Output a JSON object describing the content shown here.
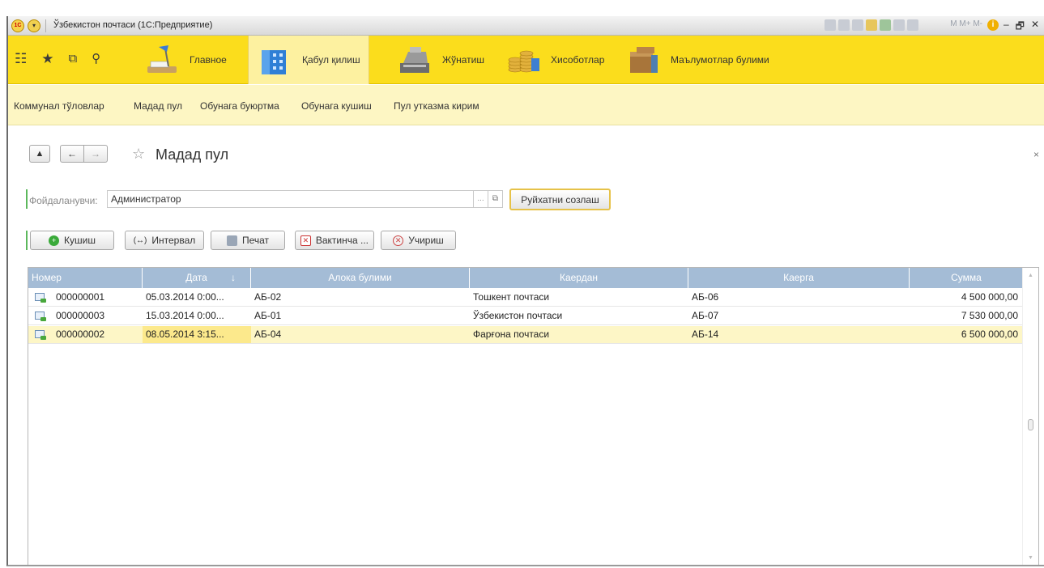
{
  "window": {
    "title": "Ўзбекистон почтаси  (1С:Предприятие)",
    "memory_label": "M  M+ M-",
    "controls": [
      "–",
      "🗗",
      "✕"
    ]
  },
  "icons": {
    "apps": "grid-icon",
    "favorites": "star-icon",
    "history": "history-icon",
    "search": "search-icon"
  },
  "sections": [
    {
      "label": "Главное",
      "icon": "desk-lamp-icon"
    },
    {
      "label": "Қабул қилиш",
      "icon": "building-icon",
      "active": true
    },
    {
      "label": "Жўнатиш",
      "icon": "cash-register-icon"
    },
    {
      "label": "Хисоботлар",
      "icon": "coins-icon"
    },
    {
      "label": "Маълумотлар булими",
      "icon": "boxes-icon"
    }
  ],
  "submenu": [
    "Коммунал тўловлар",
    "Мадад пул",
    "Обунага буюртма",
    "Обунага кушиш",
    "Пул утказма кирим"
  ],
  "form": {
    "title": "Мадад пул",
    "home": "🏠",
    "back": "←",
    "forward": "→",
    "close": "×"
  },
  "filter": {
    "label": "Фойдаланувчи:",
    "value": "Администратор",
    "dots": "...",
    "open": "⧉",
    "generate_button": "Руйхатни созлаш"
  },
  "toolbar": {
    "add": "Кушиш",
    "interval": "Интервал",
    "print": "Печат",
    "temporary": "Вактинча ...",
    "delete": "Учириш"
  },
  "table": {
    "columns": [
      "Номер",
      "Дата",
      "Алока булими",
      "Каердан",
      "Каерга",
      "Сумма"
    ],
    "sort_indicator": "↓",
    "rows": [
      {
        "number": "000000001",
        "date": "05.03.2014 0:00...",
        "branch": "АБ-02",
        "from": "Тошкент почтаси",
        "to": "АБ-06",
        "sum": "4 500 000,00"
      },
      {
        "number": "000000003",
        "date": "15.03.2014 0:00...",
        "branch": "АБ-01",
        "from": "Ўзбекистон почтаси",
        "to": "АБ-07",
        "sum": "7 530 000,00"
      },
      {
        "number": "000000002",
        "date": "08.05.2014 3:15...",
        "branch": "АБ-04",
        "from": "Фарғона почтаси",
        "to": "АБ-14",
        "sum": "6 500 000,00",
        "selected": true
      }
    ]
  },
  "colors": {
    "section_bar": "#fbdd1c",
    "submenu_bar": "#fdf6c3",
    "header_blue": "#a4bcd6",
    "selected_row": "#fdf6c6",
    "accent_green": "#5cb85c"
  }
}
